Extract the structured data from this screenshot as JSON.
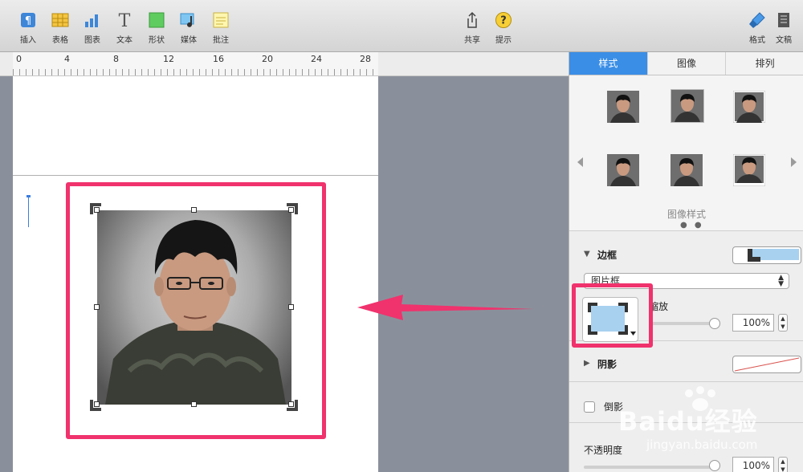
{
  "toolbar": {
    "left_items": [
      {
        "label": "插入",
        "icon": "paragraph-icon"
      },
      {
        "label": "表格",
        "icon": "table-icon"
      },
      {
        "label": "图表",
        "icon": "chart-icon"
      },
      {
        "label": "文本",
        "icon": "text-icon"
      },
      {
        "label": "形状",
        "icon": "shape-icon"
      },
      {
        "label": "媒体",
        "icon": "media-icon"
      },
      {
        "label": "批注",
        "icon": "comment-icon"
      }
    ],
    "center_items": [
      {
        "label": "共享",
        "icon": "share-icon"
      },
      {
        "label": "提示",
        "icon": "tips-icon"
      }
    ],
    "right_items": [
      {
        "label": "格式",
        "icon": "format-brush-icon"
      },
      {
        "label": "文稿",
        "icon": "document-icon"
      }
    ]
  },
  "ruler": {
    "ticks": [
      "0",
      "4",
      "8",
      "12",
      "16",
      "20",
      "24",
      "28"
    ]
  },
  "inspector": {
    "tabs": [
      {
        "label": "样式",
        "active": true
      },
      {
        "label": "图像",
        "active": false
      },
      {
        "label": "排列",
        "active": false
      }
    ],
    "styles_caption": "图像样式",
    "page_dots": "● ●",
    "border": {
      "title": "边框",
      "type_select": "图片框",
      "scale_label": "缩放",
      "scale_value": "100%"
    },
    "shadow": {
      "title": "阴影"
    },
    "reflection": {
      "label": "倒影"
    },
    "opacity": {
      "label": "不透明度",
      "value": "100%"
    }
  },
  "colors": {
    "highlight": "#f0326d",
    "accent": "#3a8ee6",
    "canvas_bg": "#8a909b"
  },
  "watermark": {
    "brand": "Baidu经验",
    "url": "jingyan.baidu.com"
  }
}
